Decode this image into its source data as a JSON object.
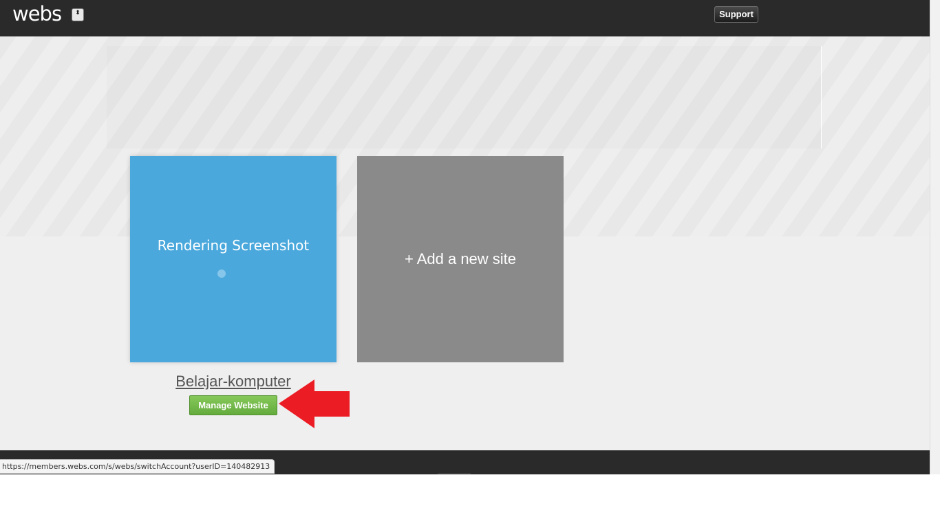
{
  "header": {
    "logo_text": "webs",
    "account_toggle_glyph": "⬍",
    "support_label": "Support"
  },
  "sites": [
    {
      "status_text": "Rendering Screenshot",
      "site_name": "Belajar-komputer",
      "manage_label": "Manage Website",
      "card_color": "#4aa8dc"
    }
  ],
  "add_site": {
    "label": "+ Add a new site",
    "card_color": "#8a8a8a"
  },
  "annotation": {
    "arrow_icon": "red-arrow-icon",
    "arrow_color": "#ec1c24"
  },
  "status_bar": {
    "url": "https://members.webs.com/s/webs/switchAccount?userID=140482913"
  },
  "colors": {
    "topbar": "#2a2a2a",
    "manage_button": "#74b94a",
    "content_bg": "#efefef"
  }
}
